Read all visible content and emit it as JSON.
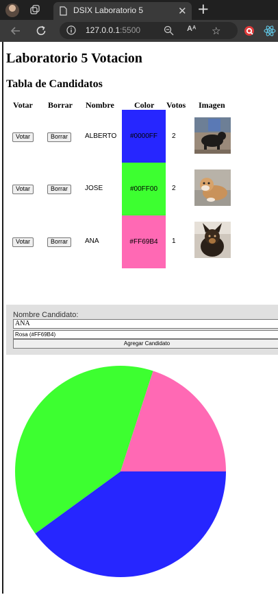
{
  "browser": {
    "tab_title": "DSIX Laboratorio 5",
    "url_host": "127.0.0.1",
    "url_port": ":5500",
    "read_aloud_label": "Aᴬ"
  },
  "page": {
    "title": "Laboratorio 5 Votacion",
    "table_heading": "Tabla de Candidatos",
    "headers": [
      "Votar",
      "Borrar",
      "Nombre",
      "Color",
      "Votos",
      "Imagen"
    ],
    "vote_label": "Votar",
    "delete_label": "Borrar",
    "candidates": [
      {
        "name": "ALBERTO",
        "color": "#0000FF",
        "swatch": "#2626ff",
        "votes": "2",
        "image": "black-dog-photo"
      },
      {
        "name": "JOSE",
        "color": "#00FF00",
        "swatch": "#3dff30",
        "votes": "2",
        "image": "bulldog-photo"
      },
      {
        "name": "ANA",
        "color": "#FF69B4",
        "swatch": "#ff69b4",
        "votes": "1",
        "image": "tricolor-dog-photo"
      }
    ]
  },
  "form": {
    "name_label": "Nombre Candidato:",
    "name_value": "ANA",
    "color_selected": "Rosa (#FF69B4)",
    "submit_label": "Agregar Candidato"
  },
  "chart_data": {
    "type": "pie",
    "labels": [
      "ALBERTO",
      "JOSE",
      "ANA"
    ],
    "values": [
      2,
      2,
      1
    ],
    "colors": [
      "#2626ff",
      "#3dff30",
      "#ff69b4"
    ]
  }
}
